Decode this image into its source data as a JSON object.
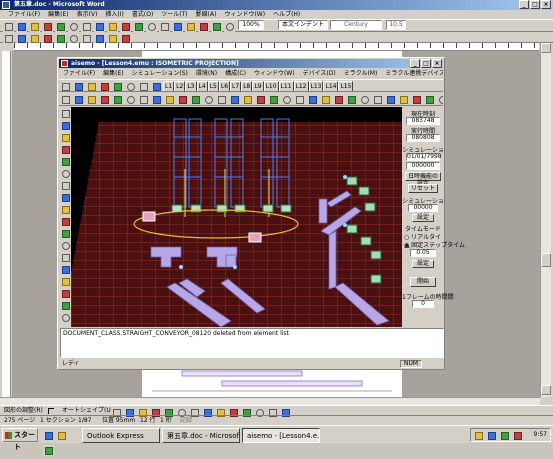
{
  "word": {
    "title": "第五章.doc - Microsoft Word",
    "menu": [
      "ファイル(F)",
      "編集(E)",
      "表示(V)",
      "挿入(I)",
      "書式(O)",
      "ツール(T)",
      "罫線(A)",
      "ウィンドウ(W)",
      "ヘルプ(H)"
    ],
    "zoom": "100%",
    "style": "本文インデント",
    "font": "Century",
    "font_size": "10.5",
    "draw_label": "図形の調整(R)",
    "autoshape_label": "オートシェイプ(U)",
    "status": {
      "page": "275 ページ",
      "section": "1 セクション",
      "pages": "1/87",
      "position": "位置 95mm",
      "line": "12 行",
      "col": "1 桁",
      "mode": "記録"
    }
  },
  "aisemo": {
    "title": "aisemo - [Lesson4.emu : ISOMETRIC PROJECTION]",
    "menu": [
      "ファイル(F)",
      "編集(E)",
      "シミュレーション(S)",
      "環境(N)",
      "構成(C)",
      "ウィンドウ(W)",
      "デバイス(D)",
      "ミラクル(M)",
      "ミラクル連携デバイス(A)",
      "特殊デバイス(D)",
      "ヘルプ(H)"
    ],
    "layers": [
      "L1",
      "L2",
      "L3",
      "L4",
      "L5",
      "L6",
      "L7",
      "L8",
      "L9",
      "L10",
      "L11",
      "L12",
      "L13",
      "L14",
      "L15"
    ],
    "panel": {
      "current_time_label": "現在時刻",
      "current_time": "083748",
      "elapsed_label": "実行時間",
      "elapsed": "080808",
      "sim_time_label": "シミュレーションタイム",
      "sim_time": "01/01/7998",
      "sim_clock": "000000",
      "set_time_button": "日時機能の設定",
      "reset_button": "リセット",
      "sim_length_label": "シミュレーションの長さ",
      "sim_length": "00000",
      "set_button": "設定",
      "time_mode_label": "タイムモード",
      "radio_real": "リアルタイム",
      "radio_fixed": "固定ステップタイム",
      "step_value": "0.05",
      "step_set_button": "設定",
      "start_button": "開始",
      "frame_label": "1フレームの時間間",
      "frame_value": "0"
    },
    "log": "DOCUMENT_CLASS.STRAIGHT_CONVEYOR_08120 deleted from element list",
    "status_left": "レディ",
    "status_right": "NUM"
  },
  "taskbar": {
    "start": "スタート",
    "items": [
      "Outlook Express",
      "第五章.doc - Microsoft...",
      "aisemo - [Lesson4.e..."
    ],
    "clock": "9:57"
  }
}
